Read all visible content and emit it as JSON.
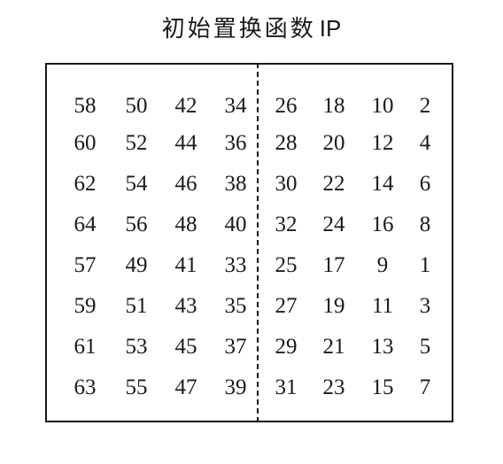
{
  "title": {
    "main": "初始置换函数",
    "suffix": "IP"
  },
  "table": {
    "rows": [
      [
        "58",
        "50",
        "42",
        "34",
        "26",
        "18",
        "10",
        "2"
      ],
      [
        "60",
        "52",
        "44",
        "36",
        "28",
        "20",
        "12",
        "4"
      ],
      [
        "62",
        "54",
        "46",
        "38",
        "30",
        "22",
        "14",
        "6"
      ],
      [
        "64",
        "56",
        "48",
        "40",
        "32",
        "24",
        "16",
        "8"
      ],
      [
        "57",
        "49",
        "41",
        "33",
        "25",
        "17",
        "9",
        "1"
      ],
      [
        "59",
        "51",
        "43",
        "35",
        "27",
        "19",
        "11",
        "3"
      ],
      [
        "61",
        "53",
        "45",
        "37",
        "29",
        "21",
        "13",
        "5"
      ],
      [
        "63",
        "55",
        "47",
        "39",
        "31",
        "23",
        "15",
        "7"
      ]
    ]
  }
}
